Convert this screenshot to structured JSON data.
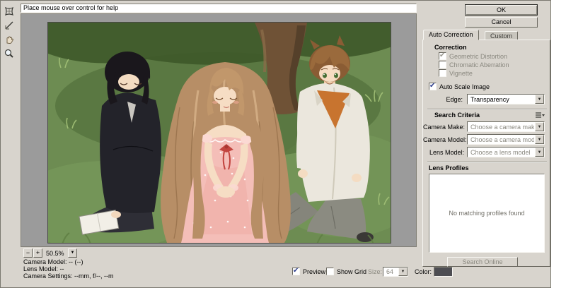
{
  "window": {
    "help_text": "Place mouse over control for help"
  },
  "buttons": {
    "ok": "OK",
    "cancel": "Cancel",
    "search_online": "Search Online"
  },
  "tabs": {
    "auto_correction": "Auto Correction",
    "custom": "Custom"
  },
  "correction": {
    "title": "Correction",
    "items": [
      {
        "label": "Geometric Distortion",
        "checked": true,
        "disabled": true
      },
      {
        "label": "Chromatic Aberration",
        "checked": false,
        "disabled": true
      },
      {
        "label": "Vignette",
        "checked": false,
        "disabled": true
      }
    ],
    "auto_scale_label": "Auto Scale Image",
    "auto_scale_checked": true,
    "edge_label": "Edge:",
    "edge_value": "Transparency"
  },
  "search_criteria": {
    "title": "Search Criteria",
    "rows": [
      {
        "label": "Camera Make:",
        "value": "Choose a camera make"
      },
      {
        "label": "Camera Model:",
        "value": "Choose a camera model"
      },
      {
        "label": "Lens Model:",
        "value": "Choose a lens model"
      }
    ]
  },
  "lens_profiles": {
    "title": "Lens Profiles",
    "empty_text": "No matching profiles found"
  },
  "status": {
    "camera_model": "Camera Model: -- (--)",
    "lens_model": "Lens Model: --",
    "camera_settings": "Camera Settings: --mm, f/--, --m"
  },
  "zoom": {
    "level": "50.5%",
    "out_glyph": "−",
    "in_glyph": "+"
  },
  "bottom_bar": {
    "preview_label": "Preview",
    "show_grid_label": "Show Grid",
    "size_label": "Size:",
    "size_value": "64",
    "color_label": "Color:",
    "color_swatch": "#4d4d52"
  },
  "icons": {
    "dropdown_arrow": "▼",
    "check": "✔"
  },
  "colors": {
    "dialog_bg": "#d8d4cd",
    "preview_bg": "#9b9b9b",
    "check_color": "#2f3f8f"
  }
}
